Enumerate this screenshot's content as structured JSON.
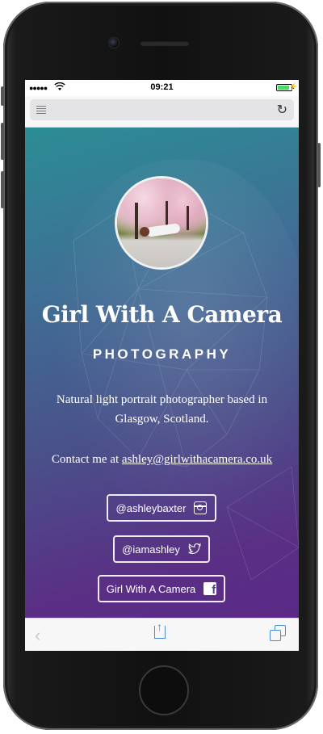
{
  "status_bar": {
    "signal": "●●●●●",
    "time": "09:21",
    "battery_level": 0.85,
    "charging_glyph": "⚡"
  },
  "address_bar": {
    "reader_icon": "reader-mode-icon",
    "reload_icon": "↻",
    "url": ""
  },
  "page": {
    "title": "Girl With A Camera",
    "subtitle": "PHOTOGRAPHY",
    "bio": "Natural light portrait photographer based in Glasgow, Scotland.",
    "contact_prefix": "Contact me at ",
    "contact_email": "ashley@girlwithacamera.co.uk",
    "social": [
      {
        "label": "@ashleybaxter",
        "icon": "instagram-icon"
      },
      {
        "label": "@iamashley",
        "icon": "twitter-icon"
      },
      {
        "label": "Girl With A Camera",
        "icon": "facebook-icon"
      }
    ]
  },
  "toolbar": {
    "back_glyph": "‹",
    "share_glyph": "↑"
  },
  "colors": {
    "gradient_top": "#2b8d95",
    "gradient_bottom": "#5b2a86",
    "ios_blue": "#4a8bd6",
    "battery_green": "#4cd964"
  }
}
